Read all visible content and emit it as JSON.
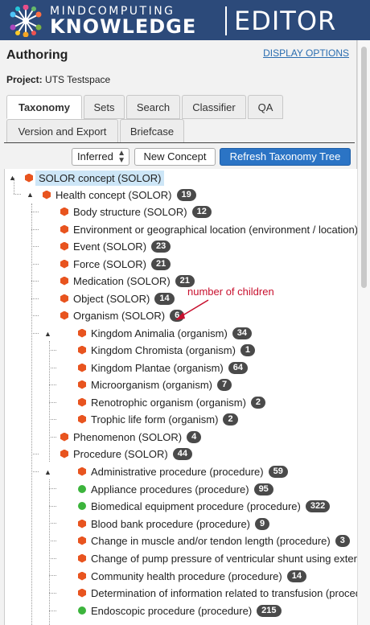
{
  "header": {
    "brand_top": "MINDCOMPUTING",
    "brand_main": "KNOWLEDGE",
    "brand_editor": "EDITOR"
  },
  "panel": {
    "title": "Authoring",
    "display_options": "DISPLAY OPTIONS",
    "project_label": "Project:",
    "project_value": "UTS Testspace"
  },
  "tabs": {
    "taxonomy": "Taxonomy",
    "sets": "Sets",
    "search": "Search",
    "classifier": "Classifier",
    "qa": "QA",
    "version_export": "Version and Export",
    "briefcase": "Briefcase"
  },
  "toolbar": {
    "view_select": "Inferred",
    "new_concept": "New Concept",
    "refresh": "Refresh Taxonomy Tree"
  },
  "annotation": "number of children",
  "tree": [
    {
      "label": "SOLOR concept (SOLOR)",
      "count": null,
      "icon": "hex"
    },
    {
      "label": "Health concept (SOLOR)",
      "count": "19",
      "icon": "hex"
    },
    {
      "label": "Body structure (SOLOR)",
      "count": "12",
      "icon": "hex"
    },
    {
      "label": "Environment or geographical location (environment / location)",
      "count": null,
      "icon": "hex"
    },
    {
      "label": "Event (SOLOR)",
      "count": "23",
      "icon": "hex"
    },
    {
      "label": "Force (SOLOR)",
      "count": "21",
      "icon": "hex"
    },
    {
      "label": "Medication (SOLOR)",
      "count": "21",
      "icon": "hex"
    },
    {
      "label": "Object (SOLOR)",
      "count": "14",
      "icon": "hex"
    },
    {
      "label": "Organism (SOLOR)",
      "count": "6",
      "icon": "hex"
    },
    {
      "label": "Kingdom Animalia (organism)",
      "count": "34",
      "icon": "hex"
    },
    {
      "label": "Kingdom Chromista (organism)",
      "count": "1",
      "icon": "hex"
    },
    {
      "label": "Kingdom Plantae (organism)",
      "count": "64",
      "icon": "hex"
    },
    {
      "label": "Microorganism (organism)",
      "count": "7",
      "icon": "hex"
    },
    {
      "label": "Renotrophic organism (organism)",
      "count": "2",
      "icon": "hex"
    },
    {
      "label": "Trophic life form (organism)",
      "count": "2",
      "icon": "hex"
    },
    {
      "label": "Phenomenon (SOLOR)",
      "count": "4",
      "icon": "hex"
    },
    {
      "label": "Procedure (SOLOR)",
      "count": "44",
      "icon": "hex"
    },
    {
      "label": "Administrative procedure (procedure)",
      "count": "59",
      "icon": "hex"
    },
    {
      "label": "Appliance procedures (procedure)",
      "count": "95",
      "icon": "dot"
    },
    {
      "label": "Biomedical equipment procedure (procedure)",
      "count": "322",
      "icon": "dot"
    },
    {
      "label": "Blood bank procedure (procedure)",
      "count": "9",
      "icon": "hex"
    },
    {
      "label": "Change in muscle and/or tendon length (procedure)",
      "count": "3",
      "icon": "hex"
    },
    {
      "label": "Change of pump pressure of ventricular shunt using external",
      "count": null,
      "icon": "hex"
    },
    {
      "label": "Community health procedure (procedure)",
      "count": "14",
      "icon": "hex"
    },
    {
      "label": "Determination of information related to transfusion (procedure)",
      "count": null,
      "icon": "hex"
    },
    {
      "label": "Endoscopic procedure (procedure)",
      "count": "215",
      "icon": "dot"
    }
  ],
  "colors": {
    "header_bg": "#2c4a7a",
    "primary_button": "#2b74c5",
    "hex_icon": "#e8541f",
    "dot_icon": "#3cb43c",
    "annotation": "#c8102e",
    "selection": "#cde6f7"
  }
}
